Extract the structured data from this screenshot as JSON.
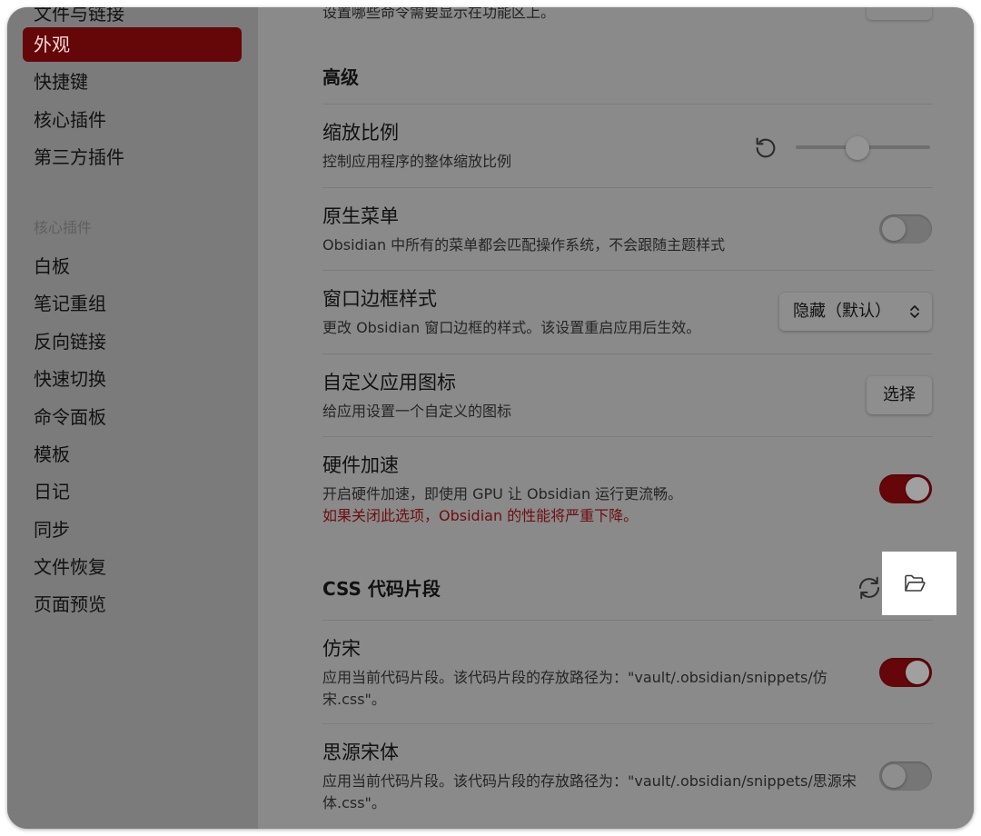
{
  "sidebar": {
    "items_top": [
      {
        "label": "文件与链接",
        "active": false
      },
      {
        "label": "外观",
        "active": true
      },
      {
        "label": "快捷键",
        "active": false
      },
      {
        "label": "核心插件",
        "active": false
      },
      {
        "label": "第三方插件",
        "active": false
      }
    ],
    "section_header": "核心插件",
    "items_plugins": [
      "白板",
      "笔记重组",
      "反向链接",
      "快速切换",
      "命令面板",
      "模板",
      "日记",
      "同步",
      "文件恢复",
      "页面预览"
    ]
  },
  "content": {
    "cut_text": "设置哪些命令需要显示在功能区上。",
    "advanced_title": "高级",
    "zoom": {
      "name": "缩放比例",
      "desc": "控制应用程序的整体缩放比例",
      "slider_fraction": 0.46
    },
    "native_menu": {
      "name": "原生菜单",
      "desc": "Obsidian 中所有的菜单都会匹配操作系统，不会跟随主题样式",
      "enabled": false
    },
    "frame_style": {
      "name": "窗口边框样式",
      "desc": "更改 Obsidian 窗口边框的样式。该设置重启应用后生效。",
      "selected": "隐藏（默认）"
    },
    "custom_icon": {
      "name": "自定义应用图标",
      "desc": "给应用设置一个自定义的图标",
      "button": "选择"
    },
    "hw_accel": {
      "name": "硬件加速",
      "desc": "开启硬件加速，即使用 GPU 让 Obsidian 运行更流畅。",
      "warning": "如果关闭此选项，Obsidian 的性能将严重下降。",
      "enabled": true
    },
    "css_title": "CSS 代码片段",
    "snippet1": {
      "name": "仿宋",
      "desc": "应用当前代码片段。该代码片段的存放路径为：\"vault/.obsidian/snippets/仿宋.css\"。",
      "enabled": true
    },
    "snippet2": {
      "name": "思源宋体",
      "desc": "应用当前代码片段。该代码片段的存放路径为：\"vault/.obsidian/snippets/思源宋体.css\"。",
      "enabled": false
    }
  },
  "colors": {
    "accent": "#65070a",
    "warning_text": "#6e0d10"
  },
  "icons": {
    "reset": "reset-icon",
    "reload": "reload-icon",
    "folder": "folder-open-icon",
    "chevron": "chevron-up-down-icon"
  }
}
